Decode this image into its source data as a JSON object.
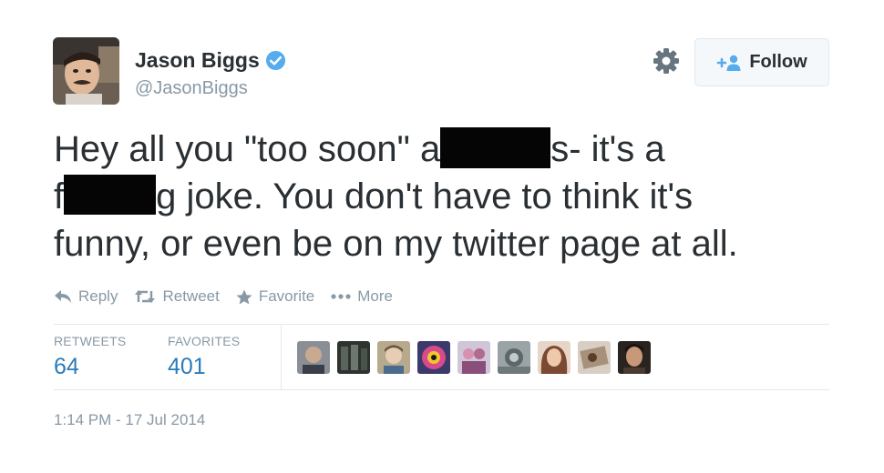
{
  "user": {
    "name": "Jason Biggs",
    "handle": "@JasonBiggs",
    "verified": true,
    "avatar_icon": "profile-photo"
  },
  "header": {
    "settings_icon": "gear-icon",
    "follow_label": "Follow"
  },
  "tweet": {
    "segments": [
      "Hey all you \"too soon\" a",
      "s- it's a",
      "f",
      "g joke. You don't have to think it's",
      "funny, or even be on my twitter page at all."
    ]
  },
  "actions": {
    "reply": "Reply",
    "retweet": "Retweet",
    "favorite": "Favorite",
    "more": "More"
  },
  "stats": {
    "retweets_label": "RETWEETS",
    "retweets_value": "64",
    "favorites_label": "FAVORITES",
    "favorites_value": "401"
  },
  "favorited_by_count": 9,
  "timestamp": "1:14 PM - 17 Jul 2014",
  "colors": {
    "text": "#292f33",
    "muted": "#8899a6",
    "link": "#2b7bb9",
    "verified": "#55acee",
    "border": "#e1e8ed"
  }
}
